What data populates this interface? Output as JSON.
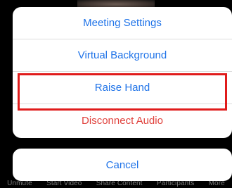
{
  "menu": {
    "items": [
      {
        "label": "Meeting Settings"
      },
      {
        "label": "Virtual Background"
      },
      {
        "label": "Raise Hand"
      },
      {
        "label": "Disconnect Audio"
      }
    ],
    "cancel_label": "Cancel"
  },
  "toolbar": {
    "items": [
      "Unmute",
      "Start Video",
      "Share Content",
      "Participants",
      "More"
    ]
  },
  "colors": {
    "action_blue": "#1f73e8",
    "destructive_red": "#e0413c",
    "highlight_red": "#e01b1b"
  }
}
